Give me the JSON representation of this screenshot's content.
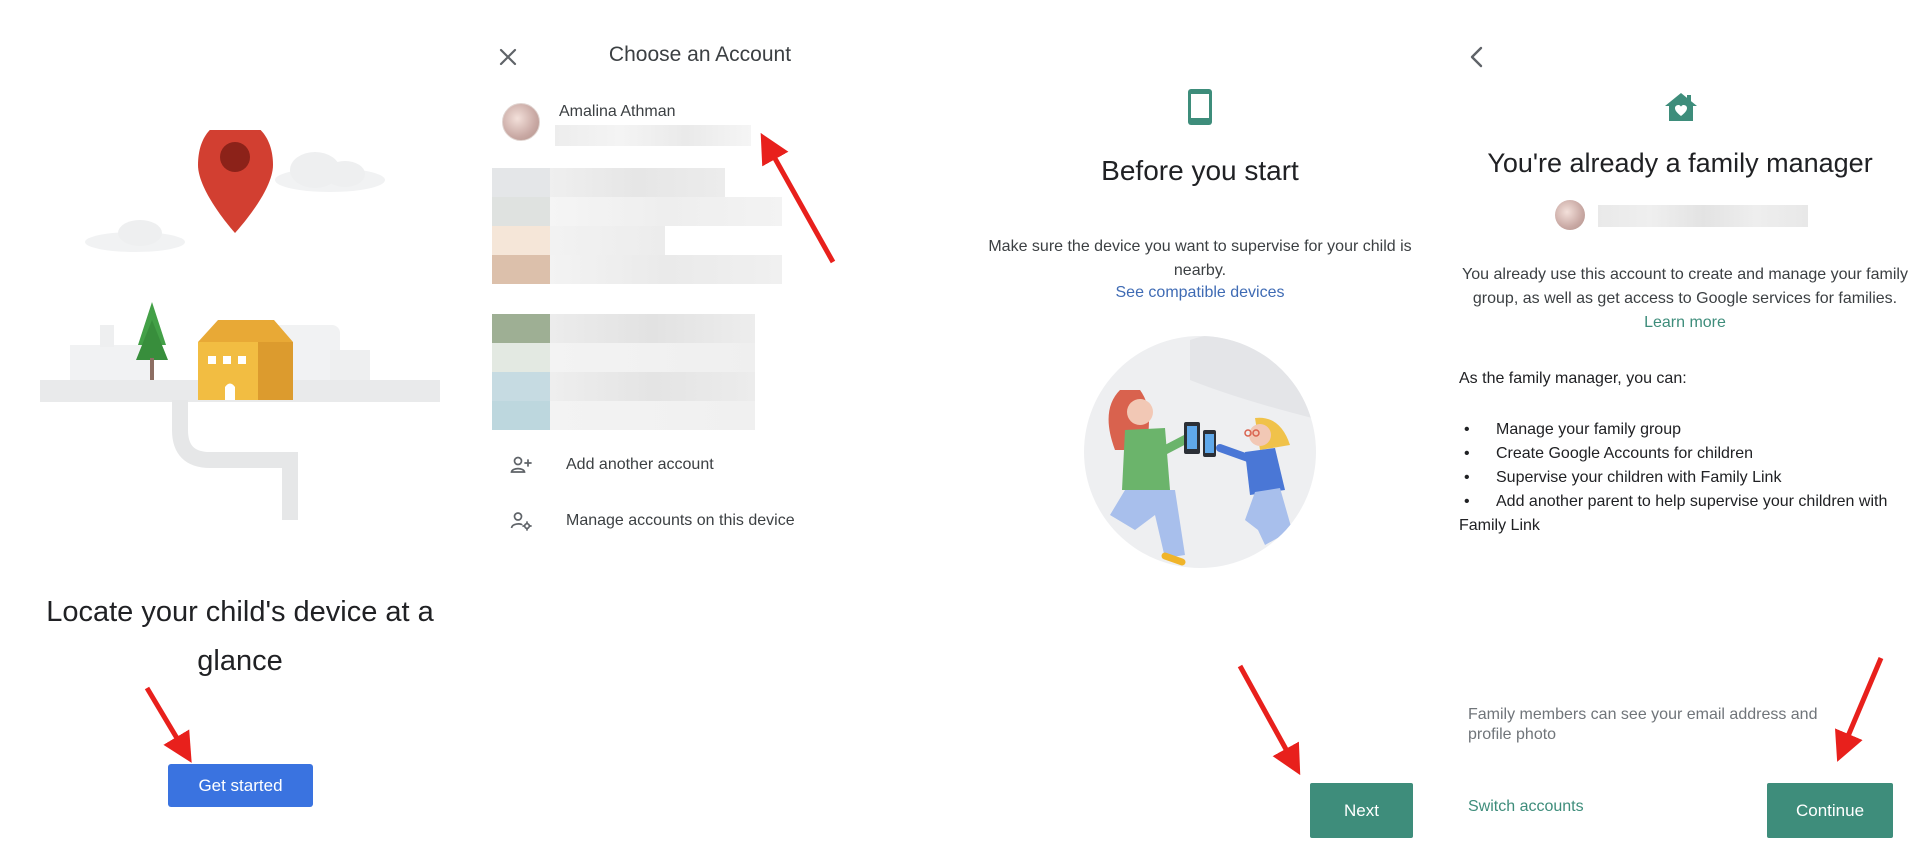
{
  "panel1": {
    "title": "Locate your child's device at a glance",
    "button_label": "Get started"
  },
  "panel2": {
    "title": "Choose an Account",
    "account_name": "Amalina Athman",
    "add_account_label": "Add another account",
    "manage_accounts_label": "Manage accounts on this device"
  },
  "panel3": {
    "title": "Before you start",
    "body": "Make sure the device you want to supervise for your child is nearby.",
    "link": "See compatible devices",
    "button_label": "Next"
  },
  "panel4": {
    "title": "You're already a family manager",
    "body": "You already use this account to create and manage your family group, as well as get access to Google services for families.",
    "learn_more": "Learn more",
    "subheading": "As the family manager, you can:",
    "list": [
      "Manage your family group",
      "Create Google Accounts for children",
      "Supervise your children with Family Link",
      "Add another parent to help supervise your children with Family Link"
    ],
    "note": "Family members can see your email address and profile photo",
    "switch_label": "Switch accounts",
    "button_label": "Continue"
  },
  "colors": {
    "blue_button": "#3a73e0",
    "green_accent": "#3e8d7b",
    "link_blue": "#3f6bb4",
    "arrow_red": "#e8201c"
  }
}
